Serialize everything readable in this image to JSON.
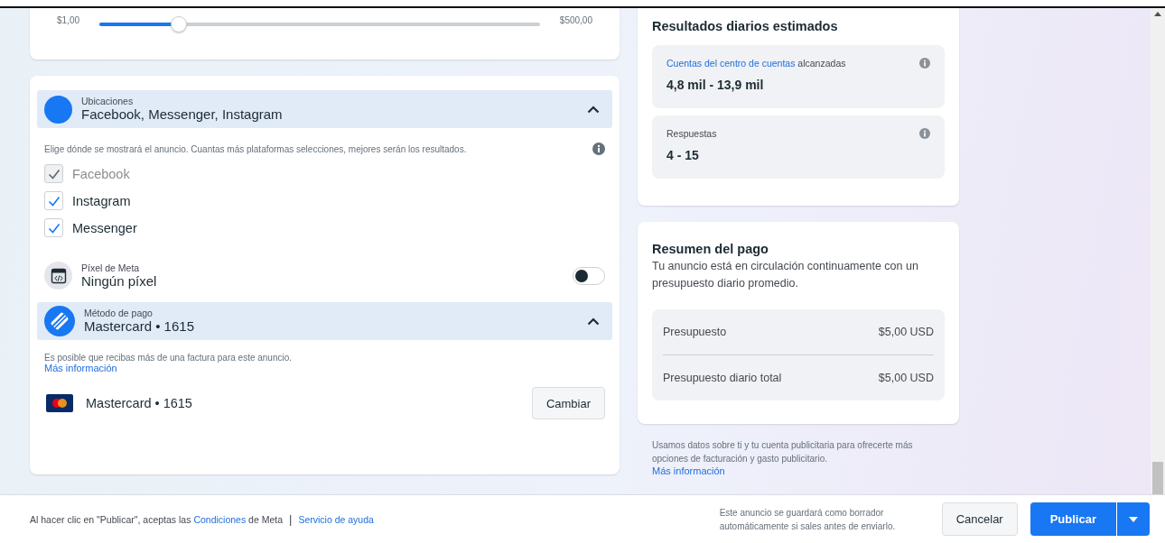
{
  "budget_slider": {
    "min_label": "$1,00",
    "max_label": "$500,00",
    "level": 0.18
  },
  "placements": {
    "label": "Ubicaciones",
    "value": "Facebook, Messenger, Instagram",
    "expanded": true,
    "hint": "Elige dónde se mostrará el anuncio. Cuantas más plataformas selecciones, mejores serán los resultados.",
    "options": [
      {
        "label": "Facebook",
        "checked": true,
        "disabled": true
      },
      {
        "label": "Instagram",
        "checked": true,
        "disabled": false
      },
      {
        "label": "Messenger",
        "checked": true,
        "disabled": false
      }
    ]
  },
  "pixel": {
    "label": "Píxel de Meta",
    "value": "Ningún píxel",
    "on": false
  },
  "payment": {
    "label": "Método de pago",
    "value": "Mastercard • 1615",
    "expanded": true,
    "note": "Es posible que recibas más de una factura para este anuncio.",
    "link": "Más información",
    "card": "Mastercard • 1615",
    "change_button": "Cambiar"
  },
  "results": {
    "title": "Resultados diarios estimados",
    "metrics": [
      {
        "label_link": "Cuentas del centro de cuentas",
        "label_rest": " alcanzadas",
        "value": "4,8 mil - 13,9 mil"
      },
      {
        "label_rest": "Respuestas",
        "value": "4 - 15"
      }
    ]
  },
  "summary": {
    "title": "Resumen del pago",
    "description": "Tu anuncio está en circulación continuamente con un presupuesto diario promedio.",
    "rows": [
      {
        "label": "Presupuesto",
        "value": "$5,00 USD"
      },
      {
        "label": "Presupuesto diario total",
        "value": "$5,00 USD"
      }
    ]
  },
  "disclaimer": {
    "text": "Usamos datos sobre ti y tu cuenta publicitaria para ofrecerte más opciones de facturación y gasto publicitario.",
    "link": "Más información"
  },
  "footer": {
    "terms_prefix": "Al hacer clic en \"Publicar\", aceptas las ",
    "terms_link": "Condiciones",
    "terms_suffix": " de Meta",
    "separator": "|",
    "help_link": "Servicio de ayuda",
    "draft_note": "Este anuncio se guardará como borrador automáticamente si sales antes de enviarlo.",
    "cancel_button": "Cancelar",
    "publish_button": "Publicar"
  }
}
